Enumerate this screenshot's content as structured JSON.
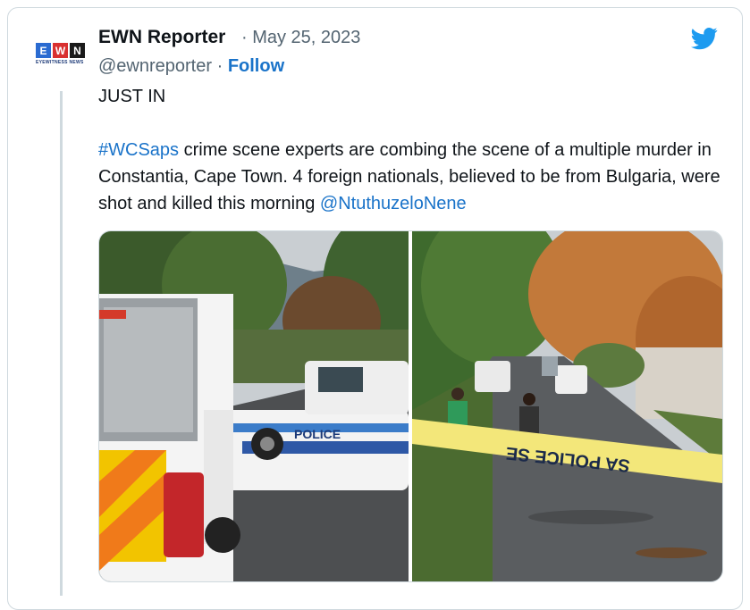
{
  "tweet": {
    "author_name": "EWN Reporter",
    "date": "· May 25, 2023",
    "handle": "@ewnreporter ·",
    "follow_label": "Follow",
    "line1": "JUST IN",
    "hashtag": "#WCSaps",
    "body_a": " crime scene experts are combing the scene of a multiple murder in Constantia, Cape Town. 4 foreign nationals, believed to be from Bulgaria, were shot and killed this morning ",
    "mention": "@NtuthuzeloNene"
  },
  "logo": {
    "letters": [
      "E",
      "W",
      "N"
    ],
    "tagline": "EYEWITNESS NEWS"
  },
  "photo_text": {
    "police": "POLICE",
    "tape": "SA POLICE SE"
  },
  "colors": {
    "link": "#1a73c9",
    "twitter_blue": "#1d9bf0",
    "border": "#cfd9de"
  },
  "icons": [
    "twitter-bird-icon"
  ]
}
